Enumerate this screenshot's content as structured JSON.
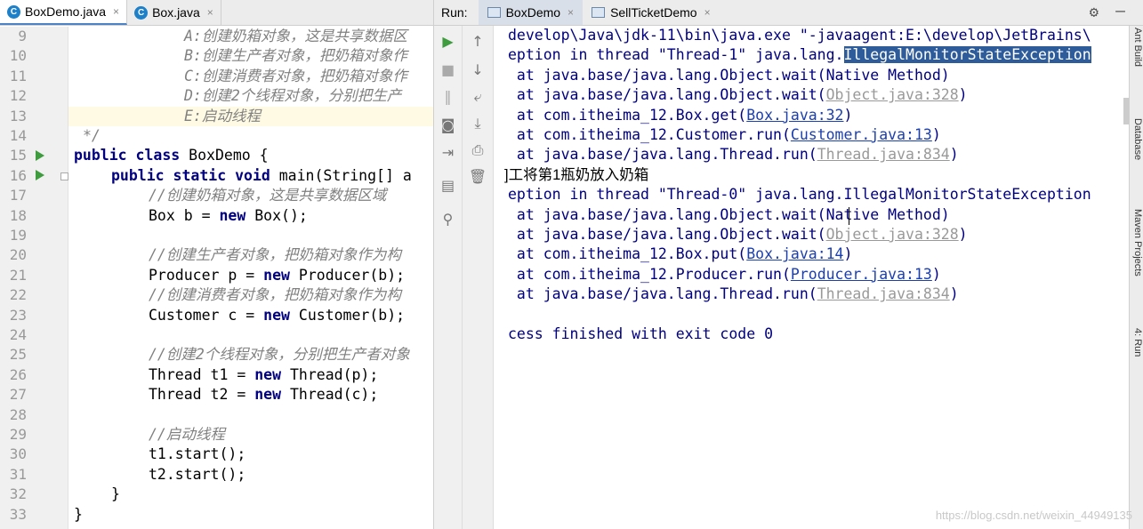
{
  "editor": {
    "tabs": [
      {
        "label": "BoxDemo.java",
        "icon": "class-icon",
        "close": "×"
      },
      {
        "label": "Box.java",
        "icon": "class-icon",
        "close": "×"
      }
    ],
    "line_numbers": [
      "9",
      "10",
      "11",
      "12",
      "13",
      "14",
      "15",
      "16",
      "17",
      "18",
      "19",
      "20",
      "21",
      "22",
      "23",
      "24",
      "25",
      "26",
      "27",
      "28",
      "29",
      "30",
      "31",
      "32",
      "33"
    ],
    "code": {
      "l9": "A:创建奶箱对象，这是共享数据区",
      "l10": "B:创建生产者对象，把奶箱对象作",
      "l11": "C:创建消费者对象，把奶箱对象作",
      "l12": "D:创建2个线程对象，分别把生产",
      "l13": "E:启动线程",
      "l14": "*/",
      "l15_kw1": "public",
      "l15_kw2": "class",
      "l15_rest": "BoxDemo {",
      "l16_kw": "public static void",
      "l16_rest": "main(String[] a",
      "l17": "//创建奶箱对象，这是共享数据区域",
      "l18_a": "Box b = ",
      "l18_kw": "new",
      "l18_b": " Box();",
      "l20": "//创建生产者对象，把奶箱对象作为构",
      "l21_a": "Producer p = ",
      "l21_kw": "new",
      "l21_b": " Producer(b);",
      "l22": "//创建消费者对象，把奶箱对象作为构",
      "l23_a": "Customer c = ",
      "l23_kw": "new",
      "l23_b": " Customer(b);",
      "l25": "//创建2个线程对象，分别把生产者对象",
      "l26_a": "Thread t1 = ",
      "l26_kw": "new",
      "l26_b": " Thread(p);",
      "l27_a": "Thread t2 = ",
      "l27_kw": "new",
      "l27_b": " Thread(c);",
      "l29": "//启动线程",
      "l30": "t1.start();",
      "l31": "t2.start();",
      "l32": "}",
      "l33": "}"
    }
  },
  "run": {
    "label": "Run:",
    "tabs": [
      {
        "label": "BoxDemo",
        "close": "×"
      },
      {
        "label": "SellTicketDemo",
        "close": "×"
      }
    ],
    "side_labels": [
      "Ant Build",
      "Database",
      "Maven Projects",
      "4: Run"
    ],
    "output": {
      "o1": "develop\\Java\\jdk-11\\bin\\java.exe \"-javaagent:E:\\develop\\JetBrains\\",
      "o2_a": "eption in thread \"Thread-1\" java.lang.",
      "o2_sel": "IllegalMonitorStateException",
      "o3": " at java.base/java.lang.Object.wait(Native Method)",
      "o4_a": " at java.base/java.lang.Object.wait(",
      "o4_link": "Object.java:328",
      "o4_b": ")",
      "o5_a": " at com.itheima_12.Box.get(",
      "o5_link": "Box.java:32",
      "o5_b": ")",
      "o6_a": " at com.itheima_12.Customer.run(",
      "o6_link": "Customer.java:13",
      "o6_b": ")",
      "o7_a": " at java.base/java.lang.Thread.run(",
      "o7_link": "Thread.java:834",
      "o7_b": ")",
      "o8": "]工将第1瓶奶放入奶箱",
      "o9": "eption in thread \"Thread-0\" java.lang.IllegalMonitorStateException",
      "o10": " at java.base/java.lang.Object.wait(Native Method)",
      "o11_a": " at java.base/java.lang.Object.wait(",
      "o11_link": "Object.java:328",
      "o11_b": ")",
      "o12_a": " at com.itheima_12.Box.put(",
      "o12_link": "Box.java:14",
      "o12_b": ")",
      "o13_a": " at com.itheima_12.Producer.run(",
      "o13_link": "Producer.java:13",
      "o13_b": ")",
      "o14_a": " at java.base/java.lang.Thread.run(",
      "o14_link": "Thread.java:834",
      "o14_b": ")",
      "o16": "cess finished with exit code 0"
    }
  },
  "watermark": "https://blog.csdn.net/weixin_44949135"
}
